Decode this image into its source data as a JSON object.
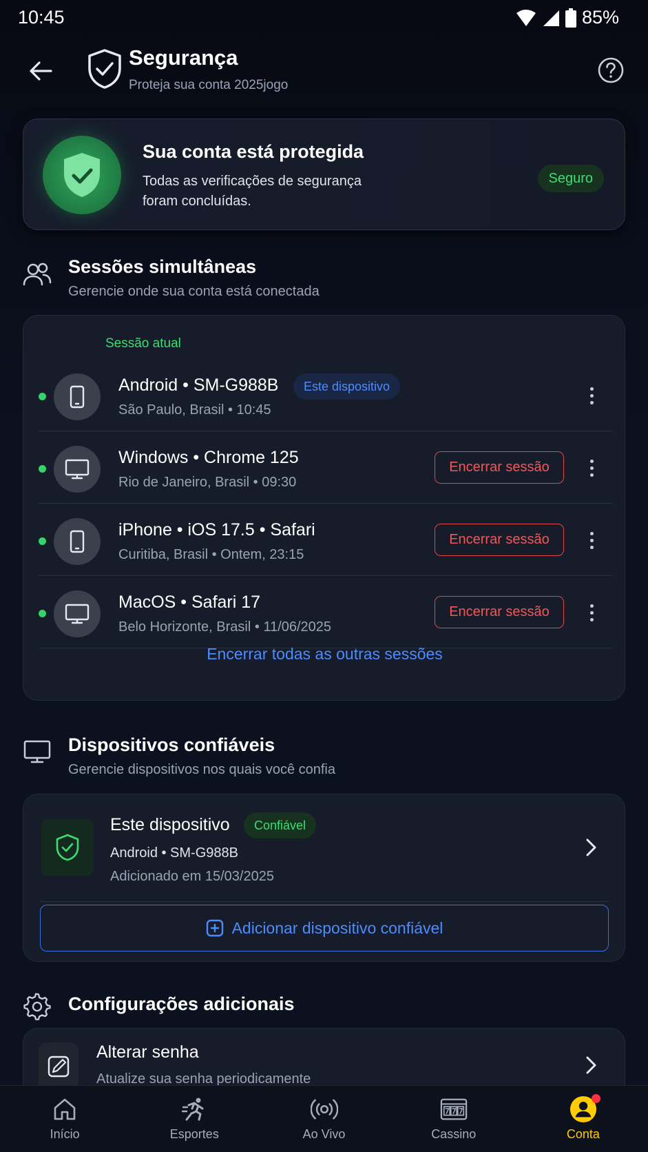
{
  "status_bar": {
    "time": "10:45",
    "battery": "85%"
  },
  "header": {
    "title": "Segurança",
    "subtitle": "Proteja sua conta 2025jogo"
  },
  "protection": {
    "title": "Sua conta está protegida",
    "description": "Todas as verificações de segurança foram concluídas.",
    "badge": "Seguro",
    "colors": {
      "accent_green": "#3ddc74"
    }
  },
  "sessions": {
    "title": "Sessões simultâneas",
    "subtitle": "Gerencie onde sua conta está conectada",
    "current_label": "Sessão atual",
    "this_device_label": "Este dispositivo",
    "end_label": "Encerrar sessão",
    "end_all_label": "Encerrar todas as outras sessões",
    "items": [
      {
        "device": "Android • SM-G988B",
        "location": "São Paulo, Brasil",
        "time": "10:45",
        "icon": "smartphone-icon",
        "current": true
      },
      {
        "device": "Windows • Chrome 125",
        "location": "Rio de Janeiro, Brasil",
        "time": "09:30",
        "icon": "monitor-icon",
        "current": false
      },
      {
        "device": "iPhone • iOS 17.5 • Safari",
        "location": "Curitiba, Brasil",
        "time": "Ontem, 23:15",
        "icon": "smartphone-icon",
        "current": false
      },
      {
        "device": "MacOS • Safari 17",
        "location": "Belo Horizonte, Brasil",
        "time": "11/06/2025",
        "icon": "monitor-icon",
        "current": false
      }
    ]
  },
  "trusted": {
    "title": "Dispositivos confiáveis",
    "subtitle": "Gerencie dispositivos nos quais você confia",
    "device_name": "Este dispositivo",
    "badge": "Confiável",
    "device_model": "Android • SM-G988B",
    "added": "Adicionado em 15/03/2025",
    "add_button": "Adicionar dispositivo confiável"
  },
  "settings": {
    "title": "Configurações adicionais",
    "change_password": {
      "title": "Alterar senha",
      "subtitle": "Atualize sua senha periodicamente"
    }
  },
  "nav": {
    "items": [
      {
        "label": "Início",
        "icon": "home-icon"
      },
      {
        "label": "Esportes",
        "icon": "running-icon"
      },
      {
        "label": "Ao Vivo",
        "icon": "live-broadcast-icon"
      },
      {
        "label": "Cassino",
        "icon": "slot-machine-icon"
      },
      {
        "label": "Conta",
        "icon": "account-icon",
        "active": true
      }
    ],
    "colors": {
      "active": "#ffcc00"
    }
  }
}
